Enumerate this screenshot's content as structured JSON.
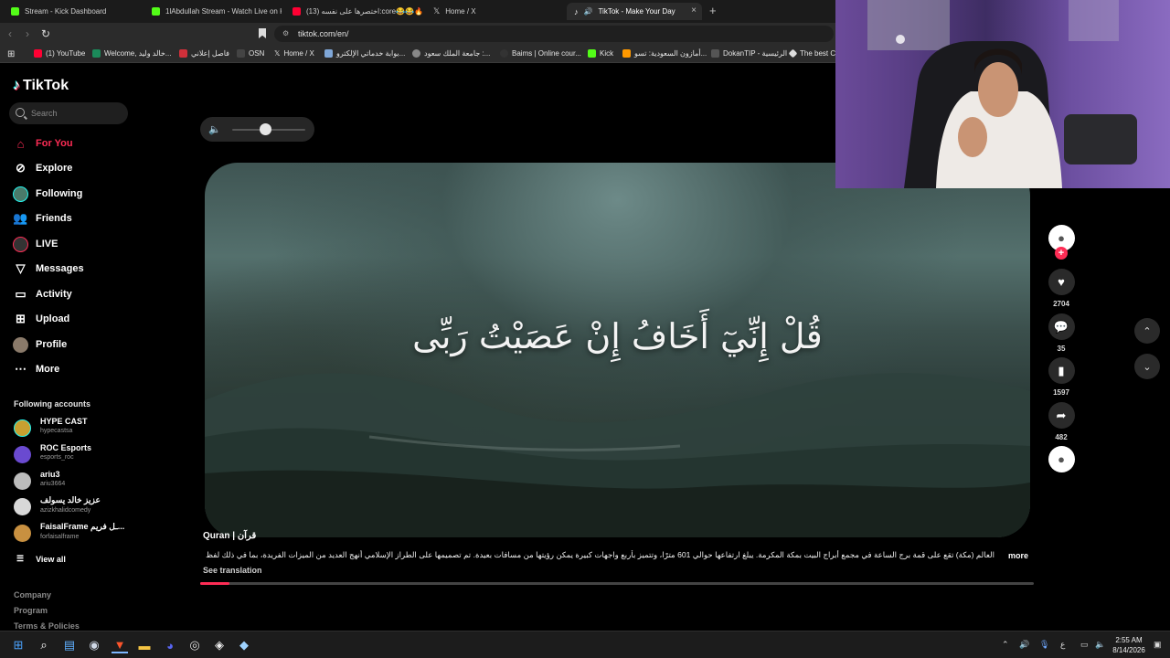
{
  "browser": {
    "tabs": [
      {
        "label": "Stream - Kick Dashboard",
        "active": false
      },
      {
        "label": "1lAbdullah Stream - Watch Live on K",
        "active": false
      },
      {
        "label": "(13) اختصرها على نفسه:core😂😂🔥ان",
        "active": false
      },
      {
        "label": "Home / X",
        "active": false
      },
      {
        "label": "TikTok - Make Your Day",
        "active": true
      }
    ],
    "tab_close": "×",
    "new_tab": "+",
    "url": "tiktok.com/en/",
    "bookmarks": [
      "(1) YouTube",
      "Welcome, خالد وليد...",
      "فاصل إعلاني",
      "OSN",
      "Home / X",
      "بوابة خدماتي الإلكترو...",
      "جامعة الملك سعود :...",
      "Baims | Online cour...",
      "Kick",
      "أمازون السعودية: تسو...",
      "DokanTIP - الرئيسية",
      "The best Cl"
    ]
  },
  "sidebar": {
    "logo": "TikTok",
    "search_placeholder": "Search",
    "nav": [
      {
        "label": "For You",
        "icon": "home-icon",
        "active": true
      },
      {
        "label": "Explore",
        "icon": "compass-icon",
        "active": false
      },
      {
        "label": "Following",
        "icon": "following-avatar-icon",
        "active": false
      },
      {
        "label": "Friends",
        "icon": "friends-icon",
        "active": false
      },
      {
        "label": "LIVE",
        "icon": "live-icon",
        "active": false
      },
      {
        "label": "Messages",
        "icon": "messages-icon",
        "active": false
      },
      {
        "label": "Activity",
        "icon": "activity-icon",
        "active": false
      },
      {
        "label": "Upload",
        "icon": "upload-icon",
        "active": false
      },
      {
        "label": "Profile",
        "icon": "profile-icon",
        "active": false
      },
      {
        "label": "More",
        "icon": "more-icon",
        "active": false
      }
    ],
    "following_title": "Following accounts",
    "accounts": [
      {
        "name": "HYPE CAST",
        "handle": "hypecastsa"
      },
      {
        "name": "ROC Esports",
        "handle": "esports_roc"
      },
      {
        "name": "ariu3",
        "handle": "ariu3664"
      },
      {
        "name": "عزيز خالد يسولف",
        "handle": "azizkhalidcomedy"
      },
      {
        "name": "FaisalFrame ـل فريم...",
        "handle": "forfaisalframe"
      }
    ],
    "view_all": "View all",
    "footer": [
      "Company",
      "Program",
      "Terms & Policies"
    ]
  },
  "video": {
    "verse": "قُلْ إِنِّيٓ أَخَافُ إِنْ عَصَيْتُ رَبِّى",
    "author": "Quran | قرآن",
    "caption": "العالم (مكة) تقع على قمة برج الساعة في مجمع أبراج البيت بمكة المكرمة. يبلغ ارتفاعها حوالي 601 مترًا، وتتميز بأربع واجهات كبيرة يمكن رؤيتها من مسافات بعيدة. تم تصميمها على الطراز الإسلامي أنهج العديد من الميزات الفريدة، بما في ذلك لفظ",
    "more": "more",
    "see_translation": "See translation",
    "volume_level": 0.45,
    "progress": 0.035
  },
  "actions": {
    "likes": "2704",
    "comments": "35",
    "saves": "1597",
    "shares": "482"
  },
  "taskbar": {
    "time": "2:55 AM",
    "date": "8/14/2026",
    "lang": "ع"
  },
  "colors": {
    "accent": "#fe2c55",
    "background": "#000000"
  }
}
